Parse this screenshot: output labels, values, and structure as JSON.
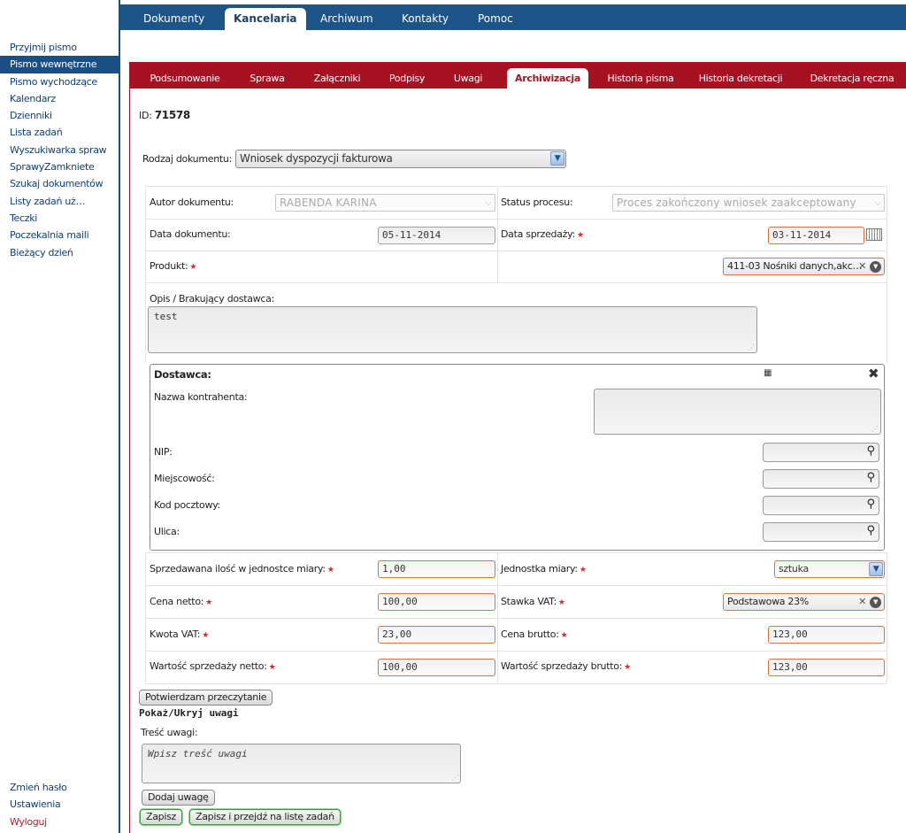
{
  "sidebar": {
    "items": [
      {
        "label": "Przyjmij pismo",
        "active": false
      },
      {
        "label": "Pismo wewnętrzne",
        "active": true
      },
      {
        "label": "Pismo wychodzące",
        "active": false
      },
      {
        "label": "Kalendarz",
        "active": false
      },
      {
        "label": "Dzienniki",
        "active": false
      },
      {
        "label": "Lista zadań",
        "active": false
      },
      {
        "label": "Wyszukiwarka spraw",
        "active": false
      },
      {
        "label": "SprawyZamkniete",
        "active": false
      },
      {
        "label": "Szukaj dokumentów",
        "active": false
      },
      {
        "label": "Listy zadań uż…",
        "active": false
      },
      {
        "label": "Teczki",
        "active": false
      },
      {
        "label": "Poczekalnia maili",
        "active": false
      },
      {
        "label": "Bieżący dzień",
        "active": false
      }
    ],
    "bottom": {
      "change_password": "Zmień hasło",
      "settings": "Ustawienia",
      "logout": "Wyloguj"
    }
  },
  "topnav": {
    "tabs": [
      "Dokumenty",
      "Kancelaria",
      "Archiwum",
      "Kontakty",
      "Pomoc"
    ],
    "active": "Kancelaria"
  },
  "subtabs": {
    "tabs": [
      "Podsumowanie",
      "Sprawa",
      "Załączniki",
      "Podpisy",
      "Uwagi",
      "Archiwizacja",
      "Historia pisma",
      "Historia dekretacji",
      "Dekretacja ręczna"
    ],
    "active": "Archiwizacja"
  },
  "doc": {
    "id_label": "ID:",
    "id_value": "71578",
    "type_label": "Rodzaj dokumentu:",
    "type_value": "Wniosek dyspozycji fakturowa"
  },
  "form": {
    "author_label": "Autor dokumentu:",
    "author_value": "RABENDA KARINA",
    "status_label": "Status procesu:",
    "status_value": "Proces zakończony wniosek zaakceptowany",
    "doc_date_label": "Data dokumentu:",
    "doc_date_value": "05-11-2014",
    "sale_date_label": "Data sprzedaży:",
    "sale_date_value": "03-11-2014",
    "product_label": "Produkt:",
    "product_value": "411-03 Nośniki danych,akc…",
    "desc_label": "Opis / Brakujący dostawca:",
    "desc_value": "test"
  },
  "supplier": {
    "title": "Dostawca:",
    "name_label": "Nazwa kontrahenta:",
    "nip_label": "NIP:",
    "city_label": "Miejscowość:",
    "postal_label": "Kod pocztowy:",
    "street_label": "Ulica:"
  },
  "pricing": {
    "qty_label": "Sprzedawana ilość w jednostce miary:",
    "qty_value": "1,00",
    "unit_label": "Jednostka miary:",
    "unit_value": "sztuka",
    "net_price_label": "Cena netto:",
    "net_price_value": "100,00",
    "vat_rate_label": "Stawka VAT:",
    "vat_rate_value": "Podstawowa 23%",
    "vat_amount_label": "Kwota VAT:",
    "vat_amount_value": "23,00",
    "gross_price_label": "Cena brutto:",
    "gross_price_value": "123,00",
    "net_sale_label": "Wartość sprzedaży netto:",
    "net_sale_value": "100,00",
    "gross_sale_label": "Wartość sprzedaży brutto:",
    "gross_sale_value": "123,00"
  },
  "notes": {
    "confirm_button": "Potwierdzam przeczytanie",
    "toggle_label": "Pokaż/Ukryj uwagi",
    "content_label": "Treść uwagi:",
    "content_placeholder": "Wpisz treść uwagi",
    "add_button": "Dodaj uwagę"
  },
  "actions": {
    "save": "Zapisz",
    "save_and_go": "Zapisz i przejdź na listę zadań"
  },
  "colors": {
    "nav_blue": "#1d5589",
    "tab_red": "#a61222",
    "required_border": "#e5703a"
  }
}
